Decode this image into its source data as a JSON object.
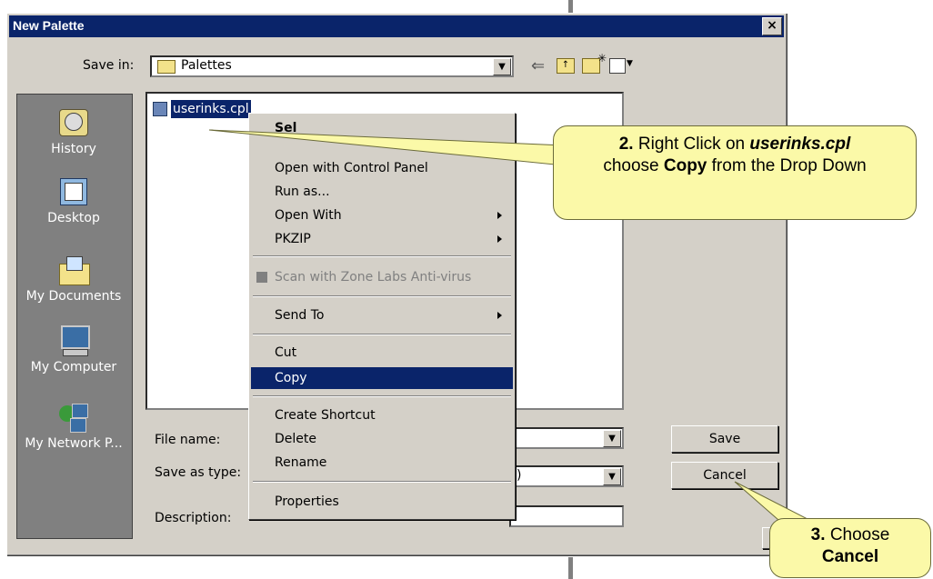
{
  "dialog": {
    "title": "New Palette",
    "close_label": "×"
  },
  "toolbar": {
    "save_in_label": "Save in:",
    "save_in_value": "Palettes",
    "back_icon": "back-arrow-icon",
    "up_icon": "up-folder-icon",
    "new_folder_icon": "new-folder-icon",
    "views_icon": "views-menu-icon"
  },
  "places": [
    {
      "label": "History",
      "icon": "history-icon"
    },
    {
      "label": "Desktop",
      "icon": "desktop-icon"
    },
    {
      "label": "My Documents",
      "icon": "my-documents-icon"
    },
    {
      "label": "My Computer",
      "icon": "my-computer-icon"
    },
    {
      "label": "My Network P...",
      "icon": "network-places-icon"
    }
  ],
  "file": {
    "name": "userinks.cpl"
  },
  "form": {
    "file_name_label": "File name:",
    "save_as_type_label": "Save as type:",
    "save_as_type_value_tail": ")",
    "description_label": "Description:"
  },
  "buttons": {
    "save": "Save",
    "cancel": "Cancel"
  },
  "context_menu": {
    "items": [
      {
        "label": "Select",
        "bold": true,
        "partial": "Sel"
      },
      {
        "label": "Open with Control Panel"
      },
      {
        "label": "Run as..."
      },
      {
        "label": "Open With",
        "submenu": true
      },
      {
        "label": "PKZIP",
        "submenu": true
      },
      {
        "label": "Scan with Zone Labs Anti-virus",
        "disabled": true
      },
      {
        "label": "Send To",
        "submenu": true
      },
      {
        "label": "Cut"
      },
      {
        "label": "Copy",
        "selected": true
      },
      {
        "label": "Create Shortcut"
      },
      {
        "label": "Delete"
      },
      {
        "label": "Rename"
      },
      {
        "label": "Properties"
      }
    ]
  },
  "callouts": {
    "step2": {
      "num": "2.",
      "text1": "Right Click on",
      "file": "userinks.cpl",
      "text2": "choose",
      "bold2": "Copy",
      "text3": "from the Drop Down"
    },
    "step3": {
      "num": "3.",
      "text1": "Choose",
      "bold": "Cancel"
    }
  },
  "colors": {
    "titlebar": "#0a246a",
    "dialog_face": "#d4d0c8",
    "callout_fill": "#fbf9a8",
    "selection": "#0a246a"
  }
}
